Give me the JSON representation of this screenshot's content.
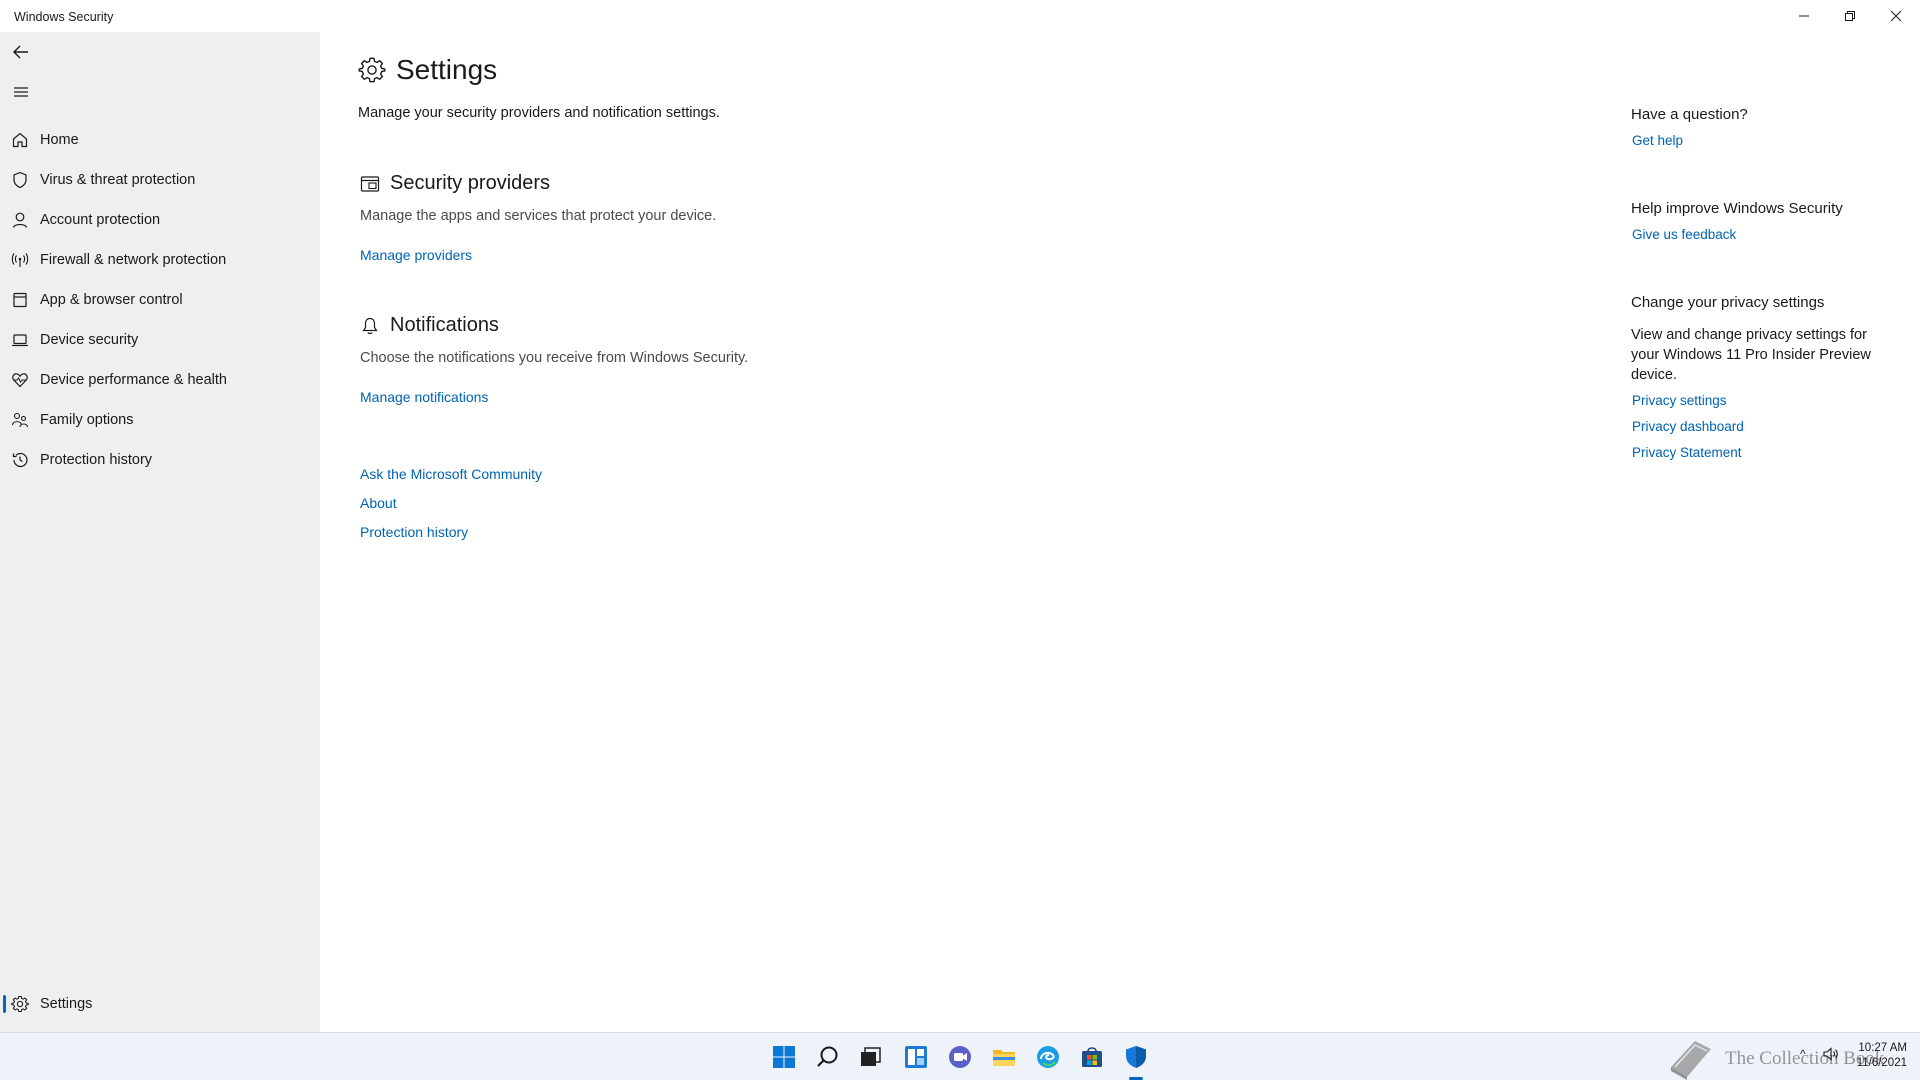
{
  "window": {
    "title": "Windows Security"
  },
  "sidebar": {
    "items": [
      {
        "label": "Home",
        "icon": "home-icon"
      },
      {
        "label": "Virus & threat protection",
        "icon": "shield-icon"
      },
      {
        "label": "Account protection",
        "icon": "person-icon"
      },
      {
        "label": "Firewall & network protection",
        "icon": "antenna-icon"
      },
      {
        "label": "App & browser control",
        "icon": "app-window-icon"
      },
      {
        "label": "Device security",
        "icon": "laptop-icon"
      },
      {
        "label": "Device performance & health",
        "icon": "heart-icon"
      },
      {
        "label": "Family options",
        "icon": "family-icon"
      },
      {
        "label": "Protection history",
        "icon": "history-icon"
      }
    ],
    "settings": {
      "label": "Settings",
      "icon": "gear-icon",
      "selected": true
    }
  },
  "main": {
    "title": "Settings",
    "subtitle": "Manage your security providers and notification settings.",
    "providers": {
      "heading": "Security providers",
      "description": "Manage the apps and services that protect your device.",
      "link": "Manage providers"
    },
    "notifications": {
      "heading": "Notifications",
      "description": "Choose the notifications you receive from Windows Security.",
      "link": "Manage notifications"
    },
    "footer_links": [
      "Ask the Microsoft Community",
      "About",
      "Protection history"
    ]
  },
  "right": {
    "question_heading": "Have a question?",
    "get_help": "Get help",
    "improve_heading": "Help improve Windows Security",
    "feedback": "Give us feedback",
    "privacy_heading": "Change your privacy settings",
    "privacy_text": "View and change privacy settings for your Windows 11 Pro Insider Preview device.",
    "privacy_links": [
      "Privacy settings",
      "Privacy dashboard",
      "Privacy Statement"
    ]
  },
  "taskbar": {
    "apps": [
      "start-icon",
      "search-icon",
      "task-view-icon",
      "widgets-icon",
      "chat-icon",
      "file-explorer-icon",
      "edge-icon",
      "store-icon",
      "windows-security-icon"
    ],
    "watermark": "The Collection Book",
    "tray_chevron": "^",
    "clock_time": "10:27 AM",
    "clock_date": "11/6/2021"
  },
  "colors": {
    "accent": "#0067c0",
    "link": "#0063b1",
    "sidebar_bg": "#efefef"
  }
}
